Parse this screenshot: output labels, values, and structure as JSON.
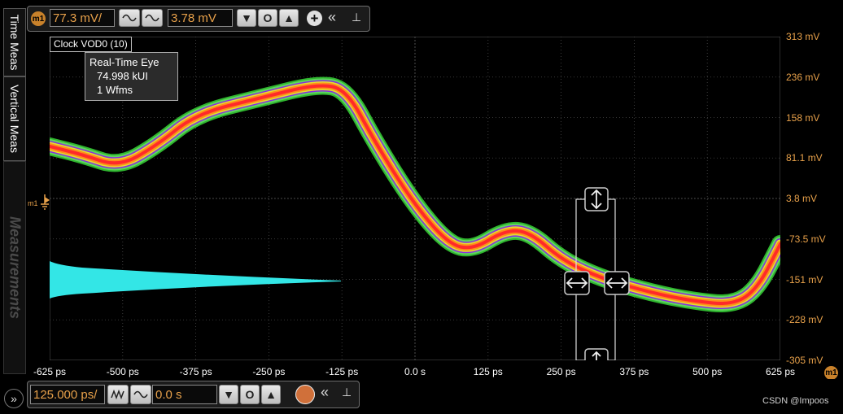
{
  "top_toolbar": {
    "channel_badge": "m1",
    "vertical_scale": "77.3 mV/",
    "vertical_offset": "3.78 mV"
  },
  "side_tabs": {
    "time_meas": "Time Meas",
    "vertical_meas": "Vertical Meas",
    "measurements": "Measurements"
  },
  "waveform_label": "Clock VOD0 (10)",
  "info_box": {
    "line1": "Real-Time Eye",
    "line2": "74.998 kUI",
    "line3": "1 Wfms"
  },
  "marker_label": "m1",
  "y_axis_labels": [
    "313 mV",
    "236 mV",
    "158 mV",
    "81.1 mV",
    "3.8 mV",
    "-73.5 mV",
    "-151 mV",
    "-228 mV",
    "-305 mV"
  ],
  "x_axis_labels": [
    "-625 ps",
    "-500 ps",
    "-375 ps",
    "-250 ps",
    "-125 ps",
    "0.0 s",
    "125 ps",
    "250 ps",
    "375 ps",
    "500 ps",
    "625 ps"
  ],
  "x_axis_badge": "m1",
  "bottom_toolbar": {
    "horizontal_scale": "125.000 ps/",
    "horizontal_position": "0.0 s"
  },
  "watermark": "CSDN @Impoos",
  "colors": {
    "accent": "#e8a14a",
    "grid": "#4a4a4a",
    "histogram": "#33e6e6"
  }
}
